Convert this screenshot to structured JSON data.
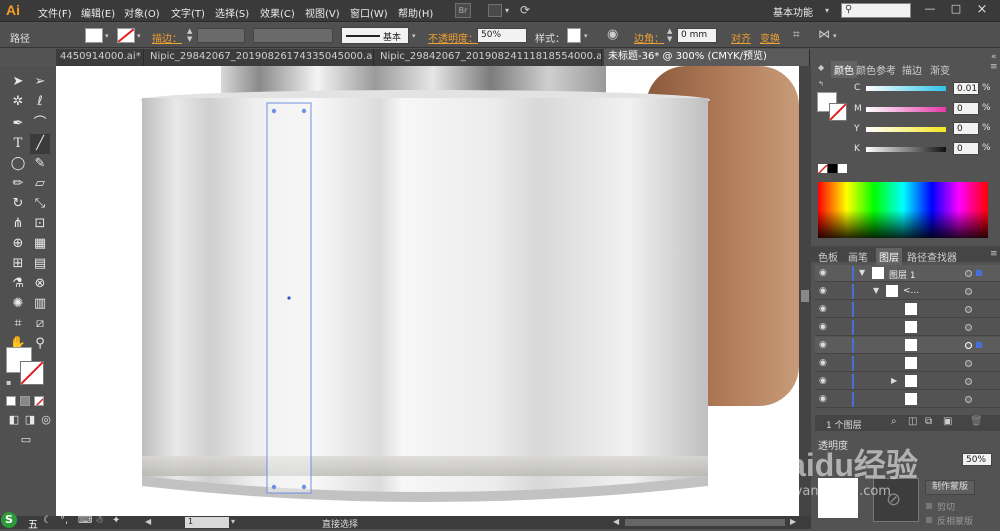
{
  "app": {
    "logo": "Ai",
    "workspace": "基本功能",
    "window_min": "—",
    "window_max": "□",
    "window_close": "×"
  },
  "menu": [
    "文件(F)",
    "编辑(E)",
    "对象(O)",
    "文字(T)",
    "选择(S)",
    "效果(C)",
    "视图(V)",
    "窗口(W)",
    "帮助(H)"
  ],
  "menu_badge": "Br",
  "control": {
    "object_type": "路径",
    "stroke_label": "描边：",
    "stroke_profile": "基本",
    "opacity_label": "不透明度：",
    "opacity_value": "50%",
    "style_label": "样式：",
    "corner_label": "边角：",
    "corner_value": "0 mm",
    "align_label": "对齐",
    "transform_label": "变换"
  },
  "tabs": [
    {
      "label": "4450914000.ai* ×",
      "active": false
    },
    {
      "label": "Nipic_29842067_20190826174335045000.ai* ×",
      "active": false
    },
    {
      "label": "Nipic_29842067_20190824111818554000.ai* ×",
      "active": false
    },
    {
      "label": "未标题-36* @ 300% (CMYK/预览)",
      "active": true
    }
  ],
  "color_panel": {
    "tabs": [
      "颜色",
      "颜色参考",
      "描边",
      "渐变"
    ],
    "channels": [
      {
        "name": "C",
        "value": "0.01",
        "percent": "%",
        "color": "#2ec4e6"
      },
      {
        "name": "M",
        "value": "0",
        "percent": "%",
        "color": "#e43aa6"
      },
      {
        "name": "Y",
        "value": "0",
        "percent": "%",
        "color": "#f5e620"
      },
      {
        "name": "K",
        "value": "0",
        "percent": "%",
        "color": "#aaaaaa"
      }
    ]
  },
  "layers_panel": {
    "tabs": [
      "色板",
      "画笔",
      "图层",
      "路径查找器"
    ],
    "top_layer": "图层 1",
    "group_label": "<...",
    "footer_count": "1 个图层"
  },
  "transparency_panel": {
    "tab": "透明度",
    "opacity": "50%",
    "make_mask": "制作蒙版",
    "clip": "剪切",
    "invert_mask": "反相蒙版"
  },
  "status": {
    "zoom": "1",
    "tool": "直接选择"
  },
  "watermark": {
    "brand": "Baidu经验",
    "url": "jingyan.baidu.com"
  },
  "ime": {
    "label": "五"
  }
}
